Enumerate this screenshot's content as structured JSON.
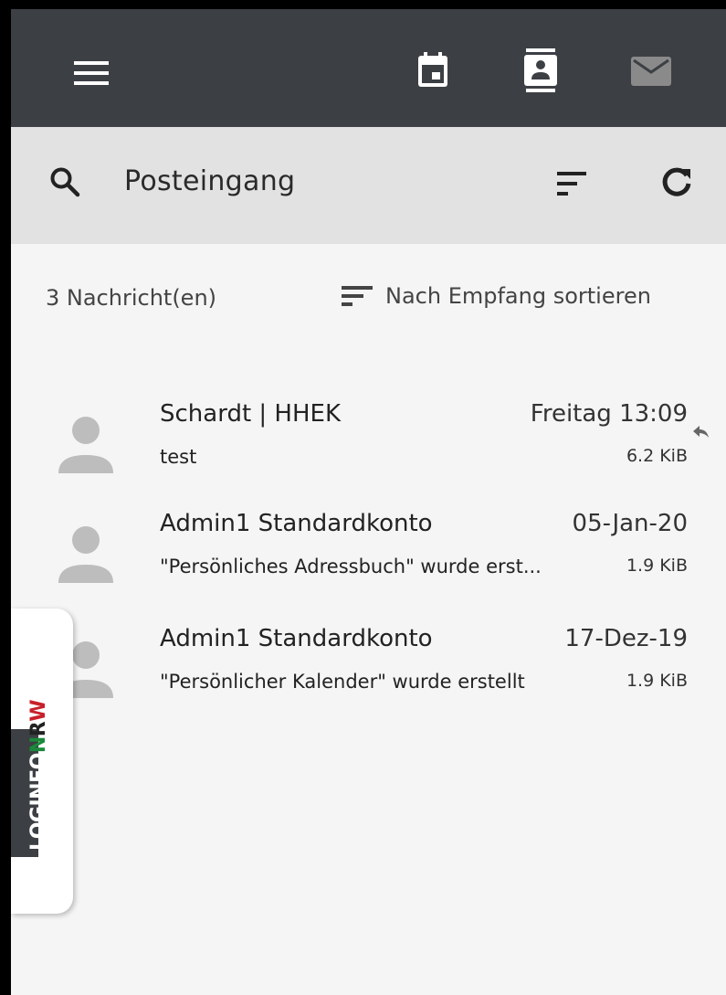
{
  "toolbar": {
    "menu_icon": "hamburger-menu-icon",
    "calendar_icon": "calendar-icon",
    "contacts_icon": "contacts-icon",
    "mail_icon": "mail-icon",
    "bar_color": "#3c3f44"
  },
  "search": {
    "icon": "search-icon",
    "folder_title": "Posteingang",
    "filter_icon": "filter-icon",
    "refresh_icon": "refresh-icon"
  },
  "summary": {
    "count": "3 Nachricht(en)",
    "sort_label": "Nach Empfang sortieren"
  },
  "messages": [
    {
      "sender": "Schardt | HHEK",
      "date": "Freitag 13:09",
      "subject": "test",
      "size": "6.2 KiB",
      "replied": true
    },
    {
      "sender": "Admin1 Standardkonto",
      "date": "05-Jan-20",
      "subject": "\"Persönliches Adressbuch\" wurde erst...",
      "size": "1.9 KiB",
      "replied": false
    },
    {
      "sender": "Admin1 Standardkonto",
      "date": "17-Dez-19",
      "subject": "\"Persönlicher Kalender\" wurde erstellt",
      "size": "1.9 KiB",
      "replied": false
    }
  ],
  "logineo": {
    "word": "LOGINEO",
    "n": "N",
    "r": "R",
    "w": "W"
  }
}
